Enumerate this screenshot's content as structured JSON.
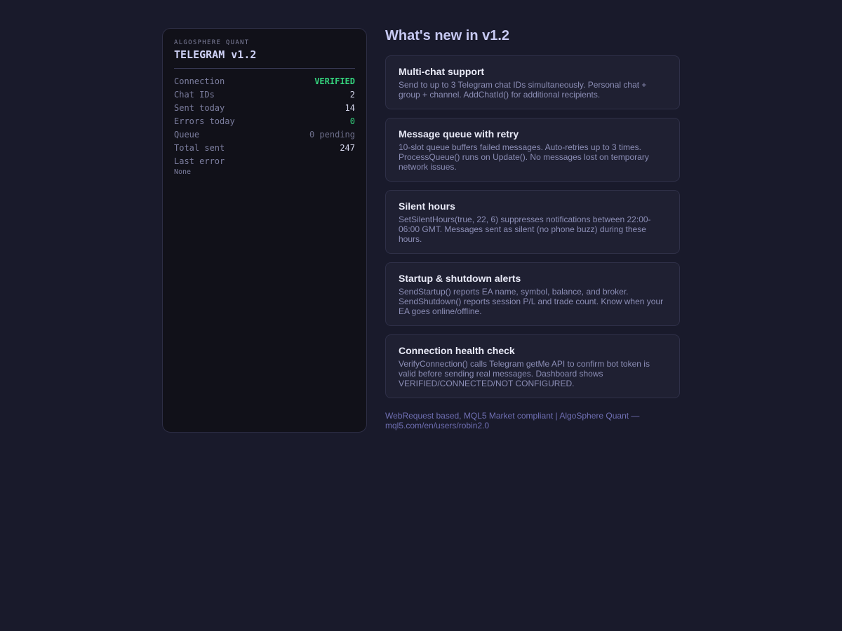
{
  "panel": {
    "brand": "ALGOSPHERE QUANT",
    "title": "TELEGRAM v1.2",
    "stats": [
      {
        "label": "Connection",
        "value": "VERIFIED"
      },
      {
        "label": "Chat IDs",
        "value": "2"
      },
      {
        "label": "Sent today",
        "value": "14"
      },
      {
        "label": "Errors today",
        "value": "0"
      },
      {
        "label": "Queue",
        "value": "0 pending"
      },
      {
        "label": "Total sent",
        "value": "247"
      }
    ],
    "last_error_label": "Last error",
    "last_error_value": "None"
  },
  "main": {
    "heading": "What's new in v1.2",
    "features": [
      {
        "title": "Multi-chat support",
        "description": "Send to up to 3 Telegram chat IDs simultaneously. Personal chat + group + channel. AddChatId() for additional recipients."
      },
      {
        "title": "Message queue with retry",
        "description": "10-slot queue buffers failed messages. Auto-retries up to 3 times. ProcessQueue() runs on Update(). No messages lost on temporary network issues."
      },
      {
        "title": "Silent hours",
        "description": "SetSilentHours(true, 22, 6) suppresses notifications between 22:00-06:00 GMT. Messages sent as silent (no phone buzz) during these hours."
      },
      {
        "title": "Startup & shutdown alerts",
        "description": "SendStartup() reports EA name, symbol, balance, and broker. SendShutdown() reports session P/L and trade count. Know when your EA goes online/offline."
      },
      {
        "title": "Connection health check",
        "description": "VerifyConnection() calls Telegram getMe API to confirm bot token is valid before sending real messages. Dashboard shows VERIFIED/CONNECTED/NOT CONFIGURED."
      }
    ],
    "footer": "WebRequest based, MQL5 Market compliant | AlgoSphere Quant — mql5.com/en/users/robin2.0"
  },
  "colors": {
    "background": "#191a2b",
    "panel_bg": "#111119",
    "card_bg": "#1f2032",
    "verified": "#34d17c",
    "heading": "#c7c9f3",
    "footer": "#6f6fb3"
  }
}
